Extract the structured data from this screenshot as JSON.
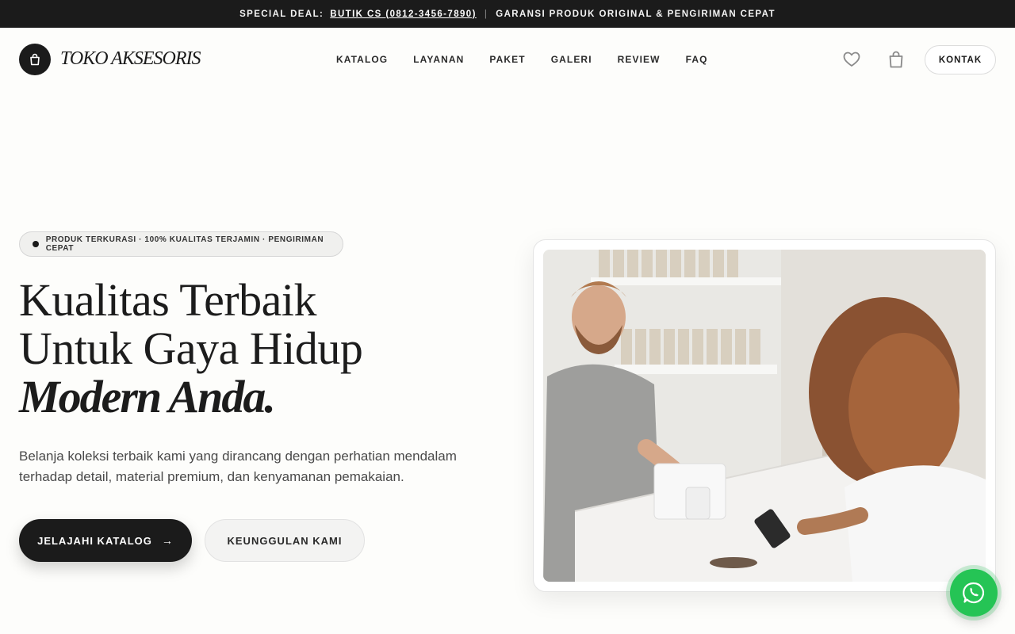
{
  "topbar": {
    "deal_label": "SPECIAL DEAL:",
    "deal_link": "BUTIK CS (0812-3456-7890)",
    "separator": "|",
    "message": "GARANSI PRODUK ORIGINAL & PENGIRIMAN CEPAT"
  },
  "header": {
    "brand": "TOKO AKSESORIS",
    "nav": [
      "KATALOG",
      "LAYANAN",
      "PAKET",
      "GALERI",
      "REVIEW",
      "FAQ"
    ],
    "contact_label": "KONTAK",
    "icons": {
      "logo": "shopping-bag-icon",
      "wishlist": "heart-icon",
      "cart": "shopping-bag-icon"
    }
  },
  "hero": {
    "badge": "PRODUK TERKURASI · 100% KUALITAS TERJAMIN · PENGIRIMAN CEPAT",
    "headline_line1": "Kualitas Terbaik",
    "headline_line2": "Untuk Gaya Hidup",
    "headline_line3": "Modern Anda.",
    "description": "Belanja koleksi terbaik kami yang dirancang dengan perhatian mendalam terhadap detail, material premium, dan kenyamanan pemakaian.",
    "primary_cta": "JELAJAHI KATALOG",
    "primary_cta_icon": "arrow-right-icon",
    "secondary_cta": "KEUNGGULAN KAMI"
  },
  "whatsapp": {
    "icon": "whatsapp-icon"
  },
  "colors": {
    "dark": "#1b1b1b",
    "background": "#fdfdfb",
    "whatsapp_green": "#25c455"
  }
}
